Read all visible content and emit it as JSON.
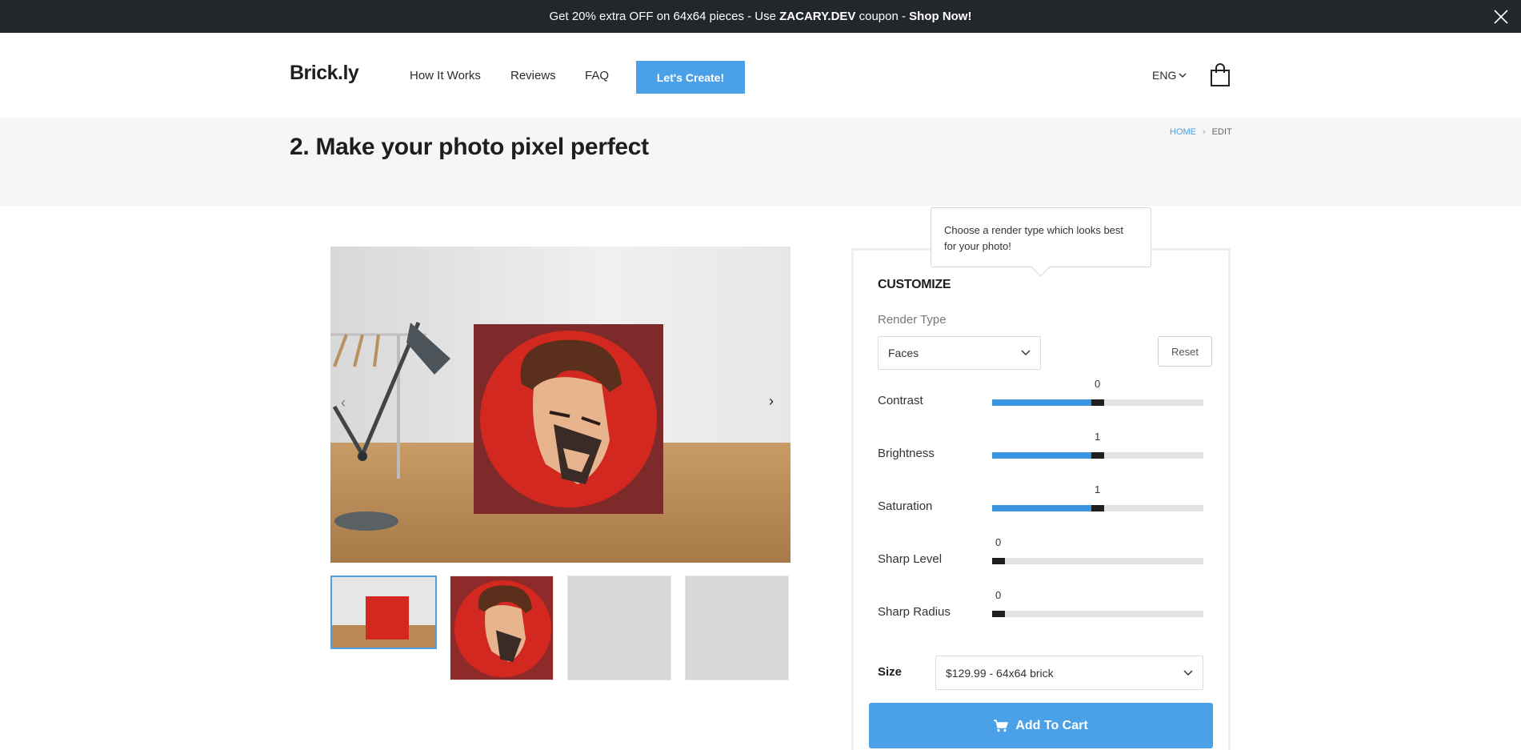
{
  "promo": {
    "text_pre": "Get 20% extra OFF on 64x64 pieces - Use ",
    "coupon": "ZACARY.DEV",
    "text_mid": " coupon - ",
    "shop_now": "Shop Now!"
  },
  "header": {
    "logo": "Brick.ly",
    "nav": [
      "How It Works",
      "Reviews",
      "FAQ"
    ],
    "cta": "Let's Create!",
    "language": "ENG"
  },
  "page": {
    "title": "2. Make your photo pixel perfect",
    "breadcrumb": [
      "HOME",
      "EDIT"
    ]
  },
  "customize": {
    "title": "CUSTOMIZE",
    "render_type_label": "Render Type",
    "render_type_value": "Faces",
    "reset_label": "Reset",
    "tooltip": "Choose a render type which looks best for your photo!",
    "sliders": [
      {
        "label": "Contrast",
        "value": "0",
        "fraction": 0.5
      },
      {
        "label": "Brightness",
        "value": "1",
        "fraction": 0.5
      },
      {
        "label": "Saturation",
        "value": "1",
        "fraction": 0.5
      },
      {
        "label": "Sharp Level",
        "value": "0",
        "fraction": 0.0
      },
      {
        "label": "Sharp Radius",
        "value": "0",
        "fraction": 0.0
      }
    ],
    "size_label": "Size",
    "size_value": "$129.99 - 64x64 brick",
    "add_to_cart": "Add To Cart"
  },
  "colors": {
    "accent": "#4aa1e8",
    "slider_fill": "#3a95e0",
    "promo_bg": "#23272b",
    "portrait_red": "#d3281f"
  }
}
